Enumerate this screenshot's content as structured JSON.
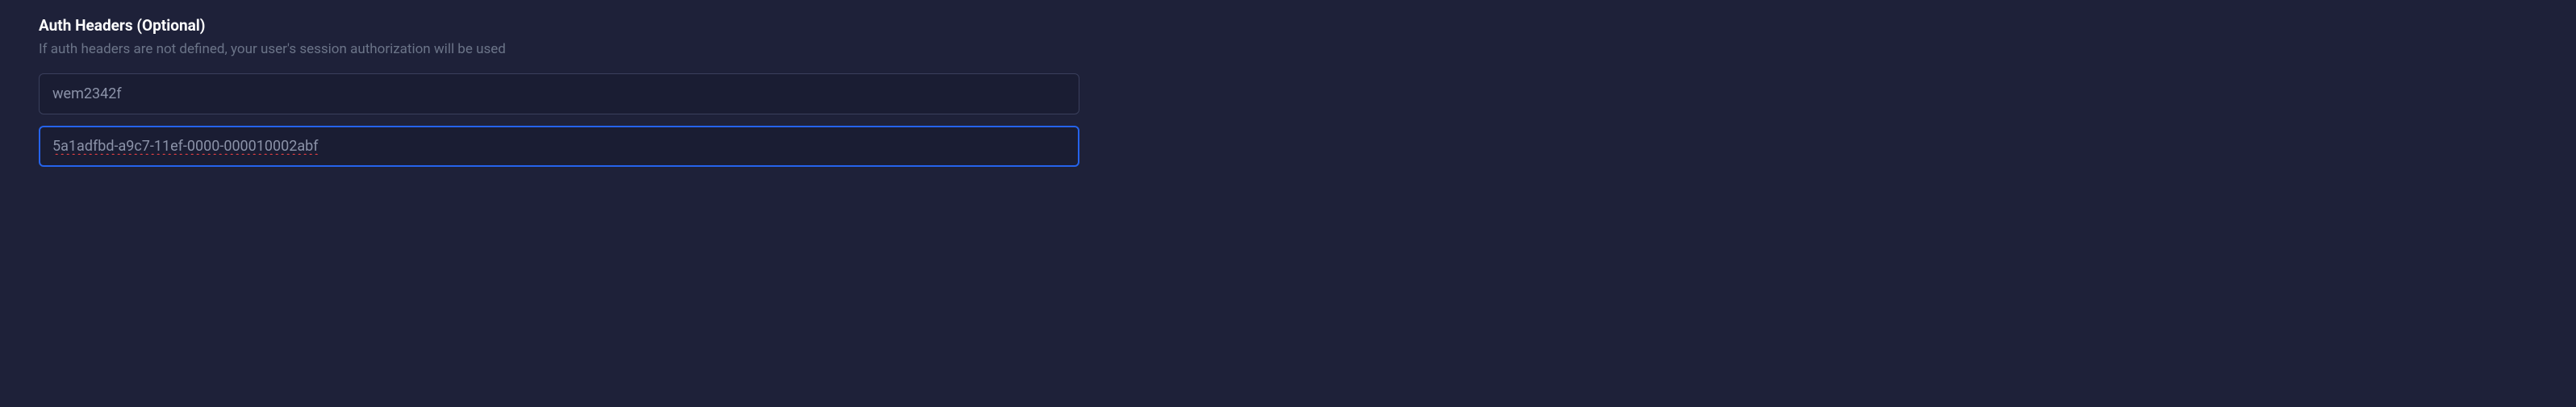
{
  "authHeaders": {
    "title": "Auth Headers (Optional)",
    "description": "If auth headers are not defined, your user's session authorization will be used",
    "input1": {
      "value": "wem2342f",
      "placeholder": ""
    },
    "input2": {
      "value": "5a1adfbd-a9c7-11ef-0000-000010002abf",
      "placeholder": ""
    }
  }
}
